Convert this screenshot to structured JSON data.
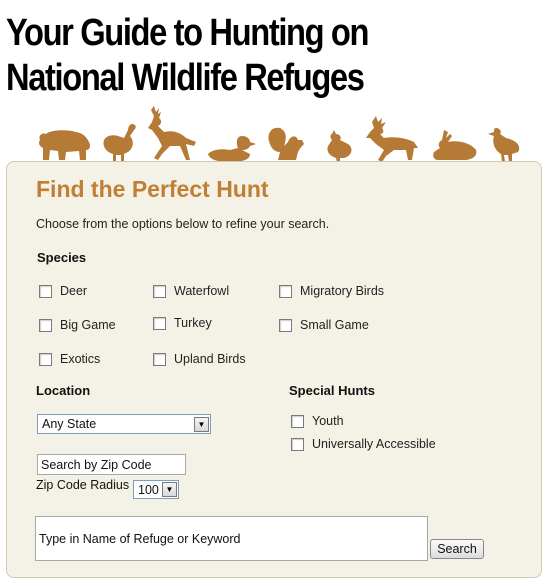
{
  "header": {
    "title_line1": "Your Guide to Hunting on",
    "title_line2": "National Wildlife Refuges"
  },
  "colors": {
    "accent": "#c07f33",
    "animal_silhouette": "#b67a37",
    "panel_background": "#f4f1e7"
  },
  "animals": [
    "bear-icon",
    "turkey-icon",
    "deer-icon",
    "duck-icon",
    "squirrel-icon",
    "quail-icon",
    "caribou-icon",
    "rabbit-icon",
    "bird-icon"
  ],
  "form": {
    "title": "Find the Perfect Hunt",
    "intro": "Choose from the options below to refine your search.",
    "species_label": "Species",
    "species": {
      "deer": "Deer",
      "waterfowl": "Waterfowl",
      "migratory_birds": "Migratory Birds",
      "big_game": "Big Game",
      "turkey": "Turkey",
      "small_game": "Small Game",
      "exotics": "Exotics",
      "upland_birds": "Upland Birds"
    },
    "location_label": "Location",
    "state_select": "Any State",
    "zip_input": "Search by Zip Code",
    "radius_label": "Zip Code Radius",
    "radius_select": "100",
    "special_label": "Special Hunts",
    "special": {
      "youth": "Youth",
      "accessible": "Universally Accessible"
    },
    "keyword_placeholder": "Type in Name of Refuge or Keyword",
    "search_button": "Search"
  }
}
